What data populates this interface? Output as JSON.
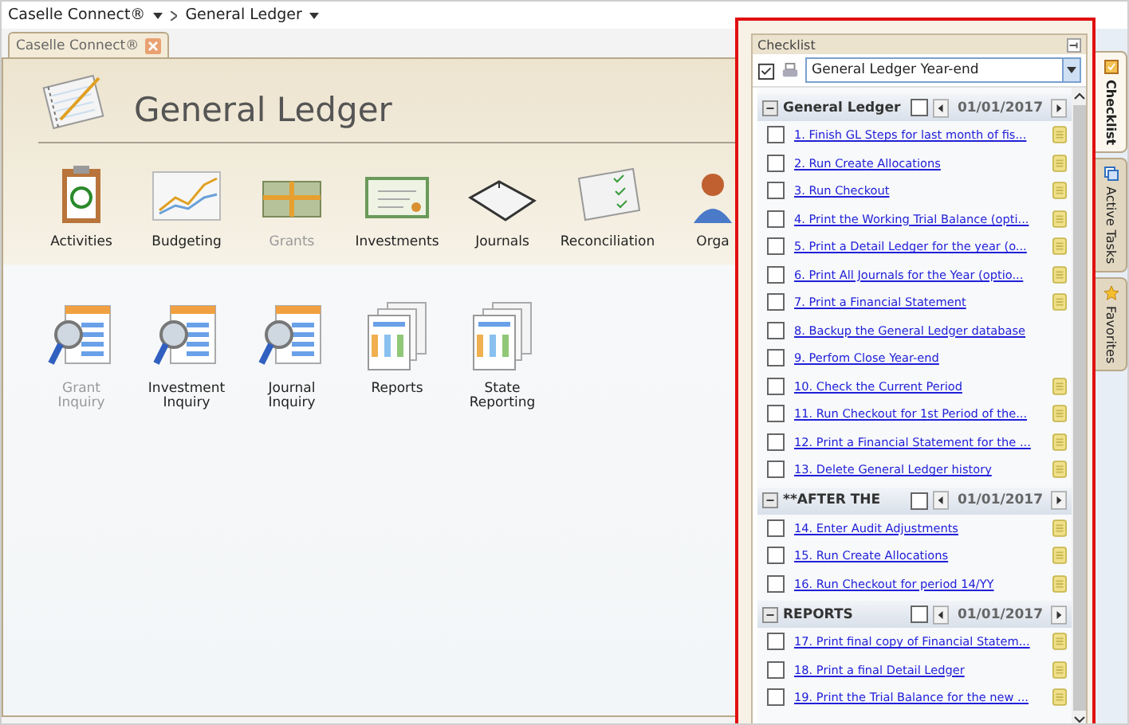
{
  "breadcrumb": {
    "root": "Caselle Connect®",
    "current": "General Ledger"
  },
  "tabs": [
    {
      "label": "Caselle Connect®",
      "selected": true
    }
  ],
  "page": {
    "title": "General Ledger"
  },
  "modules_row_1": [
    {
      "label": "Activities",
      "kind": "clipboard",
      "disabled": false
    },
    {
      "label": "Budgeting",
      "kind": "chart",
      "disabled": false
    },
    {
      "label": "Grants",
      "kind": "money",
      "disabled": true
    },
    {
      "label": "Investments",
      "kind": "certificate",
      "disabled": false
    },
    {
      "label": "Journals",
      "kind": "book",
      "disabled": false
    },
    {
      "label": "Reconciliation",
      "kind": "checkbook",
      "disabled": false
    },
    {
      "label": "Orga",
      "kind": "person",
      "disabled": false
    }
  ],
  "modules_row_2": [
    {
      "label": "Grant\nInquiry",
      "kind": "inquiry",
      "disabled": true
    },
    {
      "label": "Investment\nInquiry",
      "kind": "inquiry",
      "disabled": false
    },
    {
      "label": "Journal\nInquiry",
      "kind": "inquiry",
      "disabled": false
    },
    {
      "label": "Reports",
      "kind": "report",
      "disabled": false
    },
    {
      "label": "State\nReporting",
      "kind": "report",
      "disabled": false
    }
  ],
  "checklist": {
    "title": "Checklist",
    "selector": "General Ledger Year-end",
    "sections": [
      {
        "title": "General Ledger",
        "checked": false,
        "date": "01/01/2017",
        "items": [
          {
            "label": "1.  Finish GL Steps for last month of fis...",
            "checked": false,
            "note": true
          },
          {
            "label": "2.  Run Create Allocations",
            "checked": false,
            "note": true
          },
          {
            "label": "3.  Run Checkout",
            "checked": false,
            "note": true
          },
          {
            "label": "4.  Print the Working Trial Balance (opti...",
            "checked": false,
            "note": true
          },
          {
            "label": "5.  Print a Detail Ledger for the year (o...",
            "checked": false,
            "note": true
          },
          {
            "label": "6.  Print All Journals for the Year (optio...",
            "checked": false,
            "note": true
          },
          {
            "label": "7.  Print a Financial Statement",
            "checked": false,
            "note": true
          },
          {
            "label": "8.  Backup the General Ledger database",
            "checked": false,
            "note": false
          },
          {
            "label": "9.  Perfom Close Year-end",
            "checked": false,
            "note": false
          },
          {
            "label": "10. Check the Current Period",
            "checked": false,
            "note": true
          },
          {
            "label": "11. Run Checkout for  1st Period of the...",
            "checked": false,
            "note": true
          },
          {
            "label": "12. Print a Financial Statement for the ...",
            "checked": false,
            "note": true
          },
          {
            "label": "13. Delete General Ledger history",
            "checked": false,
            "note": true
          }
        ]
      },
      {
        "title": "**AFTER THE",
        "checked": false,
        "date": "01/01/2017",
        "items": [
          {
            "label": "14. Enter Audit Adjustments",
            "checked": false,
            "note": true
          },
          {
            "label": "15. Run Create Allocations",
            "checked": false,
            "note": true
          },
          {
            "label": "16. Run Checkout for period 14/YY",
            "checked": false,
            "note": true
          }
        ]
      },
      {
        "title": "REPORTS",
        "checked": false,
        "date": "01/01/2017",
        "items": [
          {
            "label": "17. Print final copy of Financial Statem...",
            "checked": false,
            "note": true
          },
          {
            "label": "18. Print a final Detail Ledger",
            "checked": false,
            "note": true
          },
          {
            "label": "19. Print the Trial Balance for the new ...",
            "checked": false,
            "note": true
          }
        ]
      }
    ]
  },
  "side_tabs": [
    {
      "label": "Checklist",
      "selected": true
    },
    {
      "label": "Active Tasks",
      "selected": false
    },
    {
      "label": "Favorites",
      "selected": false
    }
  ]
}
